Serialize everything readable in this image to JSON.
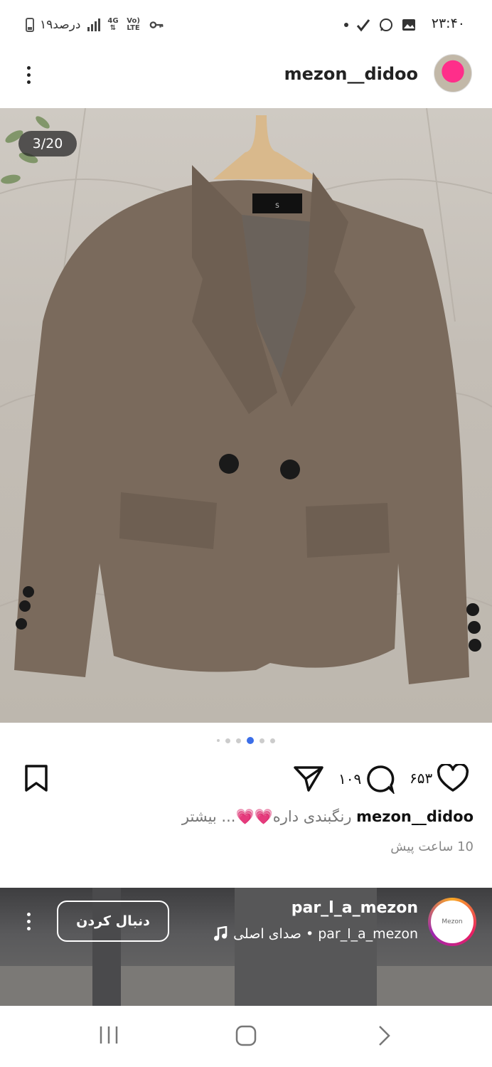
{
  "status_bar": {
    "time": "۲۳:۴۰",
    "battery_text": "۱۹درصد",
    "network": "4G",
    "volte": "Vo) LTE"
  },
  "header": {
    "username": "mezon__didoo",
    "more_icon": "more-vertical-icon"
  },
  "carousel": {
    "counter": "3/20",
    "dots_count": 6,
    "active_dot": 3
  },
  "actions": {
    "likes": "۶۵۳",
    "comments": "۱۰۹"
  },
  "caption": {
    "username": "mezon__didoo",
    "text": "رنگبندی داره💗💗... بیشتر",
    "time_ago": "10 ساعت پیش"
  },
  "suggested_reel": {
    "username": "par_l_a_mezon",
    "audio": "par_l_a_mezon • صدای اصلی",
    "follow_label": "دنبال کردن",
    "avatar_text": "Mezon"
  },
  "colors": {
    "accent_dot": "#3b6ee8",
    "jacket": "#7a6a5c"
  }
}
